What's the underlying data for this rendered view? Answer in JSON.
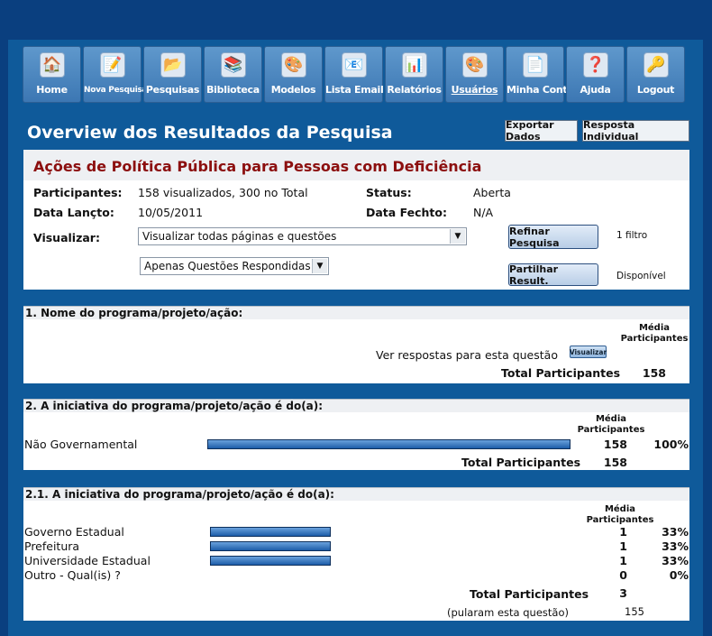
{
  "toolbar": [
    {
      "label": "Home",
      "icon": "home-icon",
      "glyph": "🏠"
    },
    {
      "label": "Nova Pesquisa",
      "icon": "new-survey-icon",
      "glyph": "📝"
    },
    {
      "label": "Pesquisas",
      "icon": "folder-icon",
      "glyph": "📂"
    },
    {
      "label": "Biblioteca",
      "icon": "library-icon",
      "glyph": "📚"
    },
    {
      "label": "Modelos",
      "icon": "palette-icon",
      "glyph": "🎨"
    },
    {
      "label": "Lista Email",
      "icon": "email-list-icon",
      "glyph": "📧"
    },
    {
      "label": "Relatórios",
      "icon": "reports-icon",
      "glyph": "📊"
    },
    {
      "label": "Usuários",
      "icon": "users-icon",
      "glyph": "🎨"
    },
    {
      "label": "Minha Conta",
      "icon": "account-icon",
      "glyph": "📄"
    },
    {
      "label": "Ajuda",
      "icon": "help-icon",
      "glyph": "❓"
    },
    {
      "label": "Logout",
      "icon": "key-icon",
      "glyph": "🔑"
    }
  ],
  "header": {
    "title": "Overview dos Resultados da Pesquisa",
    "export_label": "Exportar Dados",
    "individual_label": "Resposta Individual"
  },
  "survey": {
    "title": "Ações de Política Pública para Pessoas com Deficiência",
    "participants_label": "Participantes:",
    "participants_value": "158 visualizados, 300 no Total",
    "status_label": "Status:",
    "status_value": "Aberta",
    "launch_label": "Data Lançto:",
    "launch_value": "10/05/2011",
    "close_label": "Data Fechto:",
    "close_value": "N/A",
    "view_label": "Visualizar:",
    "view_select": "Visualizar todas páginas e questões",
    "answered_select": "Apenas Questões Respondidas",
    "refine_label": "Refinar Pesquisa",
    "filter_note": "1 filtro",
    "share_label": "Partilhar Result.",
    "share_note": "Disponível"
  },
  "q1": {
    "title": "1. Nome do programa/projeto/ação:",
    "col_line1": "Média",
    "col_line2": "Participantes",
    "see_answers": "Ver respostas para esta questão",
    "view_btn": "Visualizar",
    "total_label": "Total Participantes",
    "total_value": "158"
  },
  "q2": {
    "title": "2. A iniciativa do programa/projeto/ação é do(a):",
    "col_line1": "Média",
    "col_line2": "Participantes",
    "rows": [
      {
        "label": "Não Governamental",
        "count": "158",
        "pct": "100%",
        "fraction": 1.0
      }
    ],
    "total_label": "Total Participantes",
    "total_value": "158"
  },
  "q21": {
    "title": "2.1. A iniciativa do programa/projeto/ação é do(a):",
    "col_line1": "Média",
    "col_line2": "Participantes",
    "rows": [
      {
        "label": "Governo Estadual",
        "count": "1",
        "pct": "33%",
        "fraction": 0.33
      },
      {
        "label": "Prefeitura",
        "count": "1",
        "pct": "33%",
        "fraction": 0.33
      },
      {
        "label": "Universidade Estadual",
        "count": "1",
        "pct": "33%",
        "fraction": 0.33
      },
      {
        "label": "Outro - Qual(is) ?",
        "count": "0",
        "pct": "0%",
        "fraction": 0.0
      }
    ],
    "total_label": "Total Participantes",
    "total_value": "3",
    "skipped_label": "(pularam esta questão)",
    "skipped_value": "155"
  }
}
